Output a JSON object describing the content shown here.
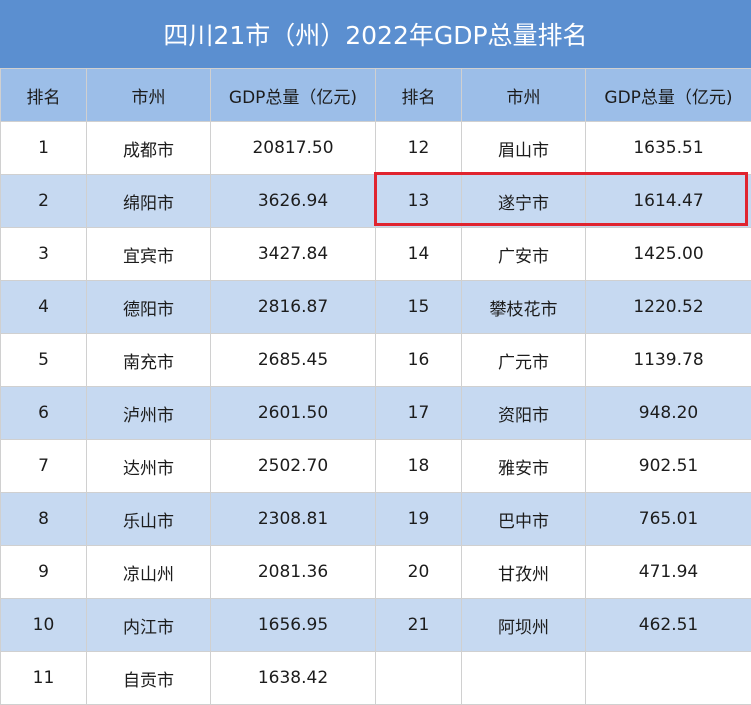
{
  "title": "四川21市（州）2022年GDP总量排名",
  "headers": {
    "rank": "排名",
    "city": "市州",
    "gdp": "GDP总量（亿元)"
  },
  "left_rows": [
    {
      "rank": "1",
      "city": "成都市",
      "gdp": "20817.50"
    },
    {
      "rank": "2",
      "city": "绵阳市",
      "gdp": "3626.94"
    },
    {
      "rank": "3",
      "city": "宜宾市",
      "gdp": "3427.84"
    },
    {
      "rank": "4",
      "city": "德阳市",
      "gdp": "2816.87"
    },
    {
      "rank": "5",
      "city": "南充市",
      "gdp": "2685.45"
    },
    {
      "rank": "6",
      "city": "泸州市",
      "gdp": "2601.50"
    },
    {
      "rank": "7",
      "city": "达州市",
      "gdp": "2502.70"
    },
    {
      "rank": "8",
      "city": "乐山市",
      "gdp": "2308.81"
    },
    {
      "rank": "9",
      "city": "凉山州",
      "gdp": "2081.36"
    },
    {
      "rank": "10",
      "city": "内江市",
      "gdp": "1656.95"
    },
    {
      "rank": "11",
      "city": "自贡市",
      "gdp": "1638.42"
    }
  ],
  "right_rows": [
    {
      "rank": "12",
      "city": "眉山市",
      "gdp": "1635.51"
    },
    {
      "rank": "13",
      "city": "遂宁市",
      "gdp": "1614.47"
    },
    {
      "rank": "14",
      "city": "广安市",
      "gdp": "1425.00"
    },
    {
      "rank": "15",
      "city": "攀枝花市",
      "gdp": "1220.52"
    },
    {
      "rank": "16",
      "city": "广元市",
      "gdp": "1139.78"
    },
    {
      "rank": "17",
      "city": "资阳市",
      "gdp": "948.20"
    },
    {
      "rank": "18",
      "city": "雅安市",
      "gdp": "902.51"
    },
    {
      "rank": "19",
      "city": "巴中市",
      "gdp": "765.01"
    },
    {
      "rank": "20",
      "city": "甘孜州",
      "gdp": "471.94"
    },
    {
      "rank": "21",
      "city": "阿坝州",
      "gdp": "462.51"
    }
  ],
  "colors": {
    "title_bg": "#5b8fd0",
    "header_bg": "#9cbee8",
    "alt_row_bg": "#c6d9f1",
    "highlight_border": "#e0242f"
  }
}
